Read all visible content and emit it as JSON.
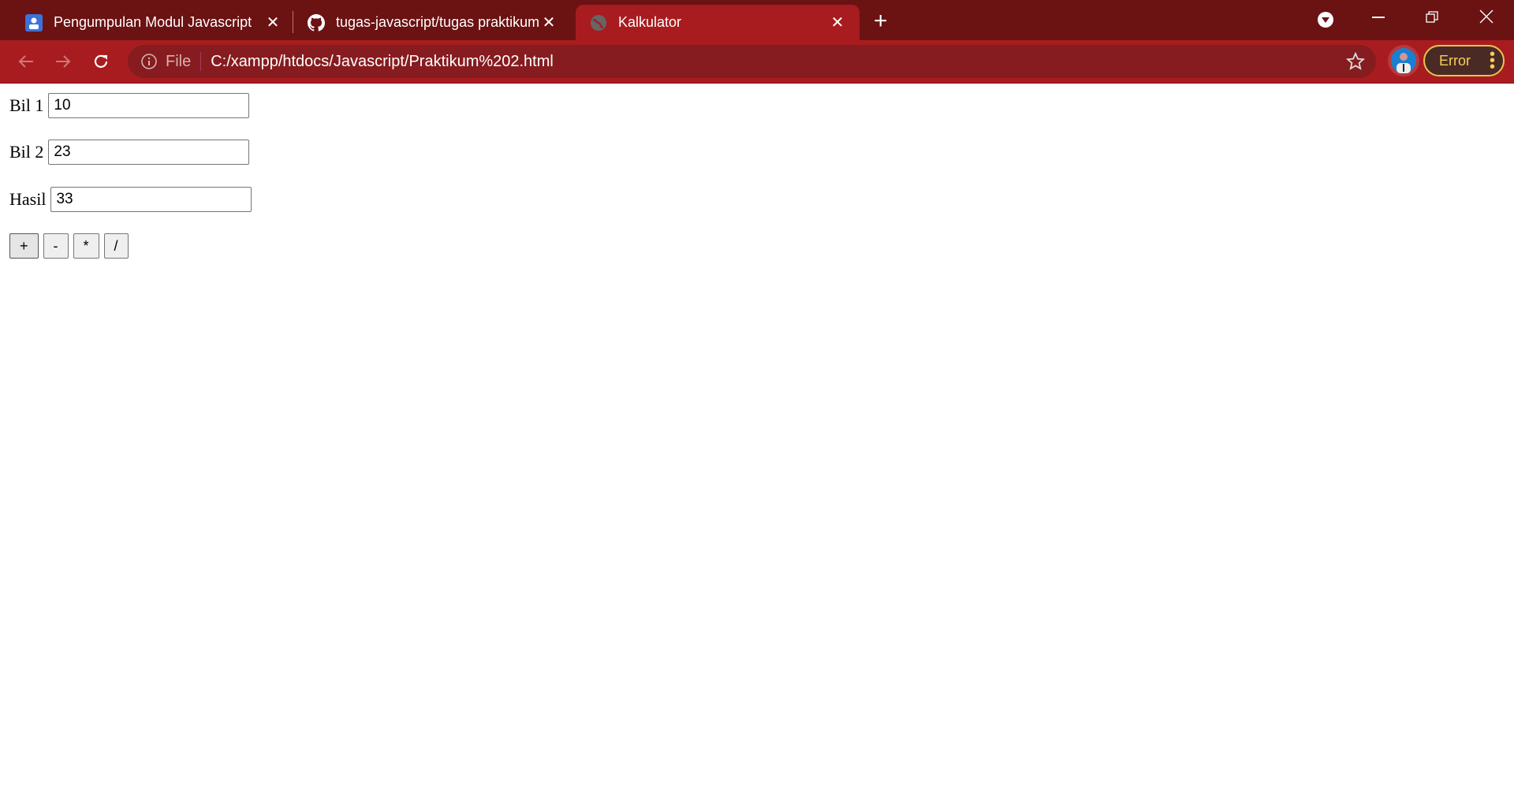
{
  "browser": {
    "tabs": [
      {
        "title": "Pengumpulan Modul Javascript",
        "icon": "classroom-icon"
      },
      {
        "title": "tugas-javascript/tugas praktikum",
        "icon": "github-icon"
      },
      {
        "title": "Kalkulator",
        "icon": "globe-icon",
        "active": true
      }
    ],
    "address": {
      "scheme_label": "File",
      "url": "C:/xampp/htdocs/Javascript/Praktikum%202.html"
    },
    "error_label": "Error",
    "theme_color": "#a81c1f"
  },
  "page": {
    "fields": [
      {
        "label": "Bil 1",
        "value": "10"
      },
      {
        "label": "Bil 2",
        "value": "23"
      },
      {
        "label": "Hasil",
        "value": "33"
      }
    ],
    "operators": [
      "+",
      "-",
      "*",
      "/"
    ]
  }
}
